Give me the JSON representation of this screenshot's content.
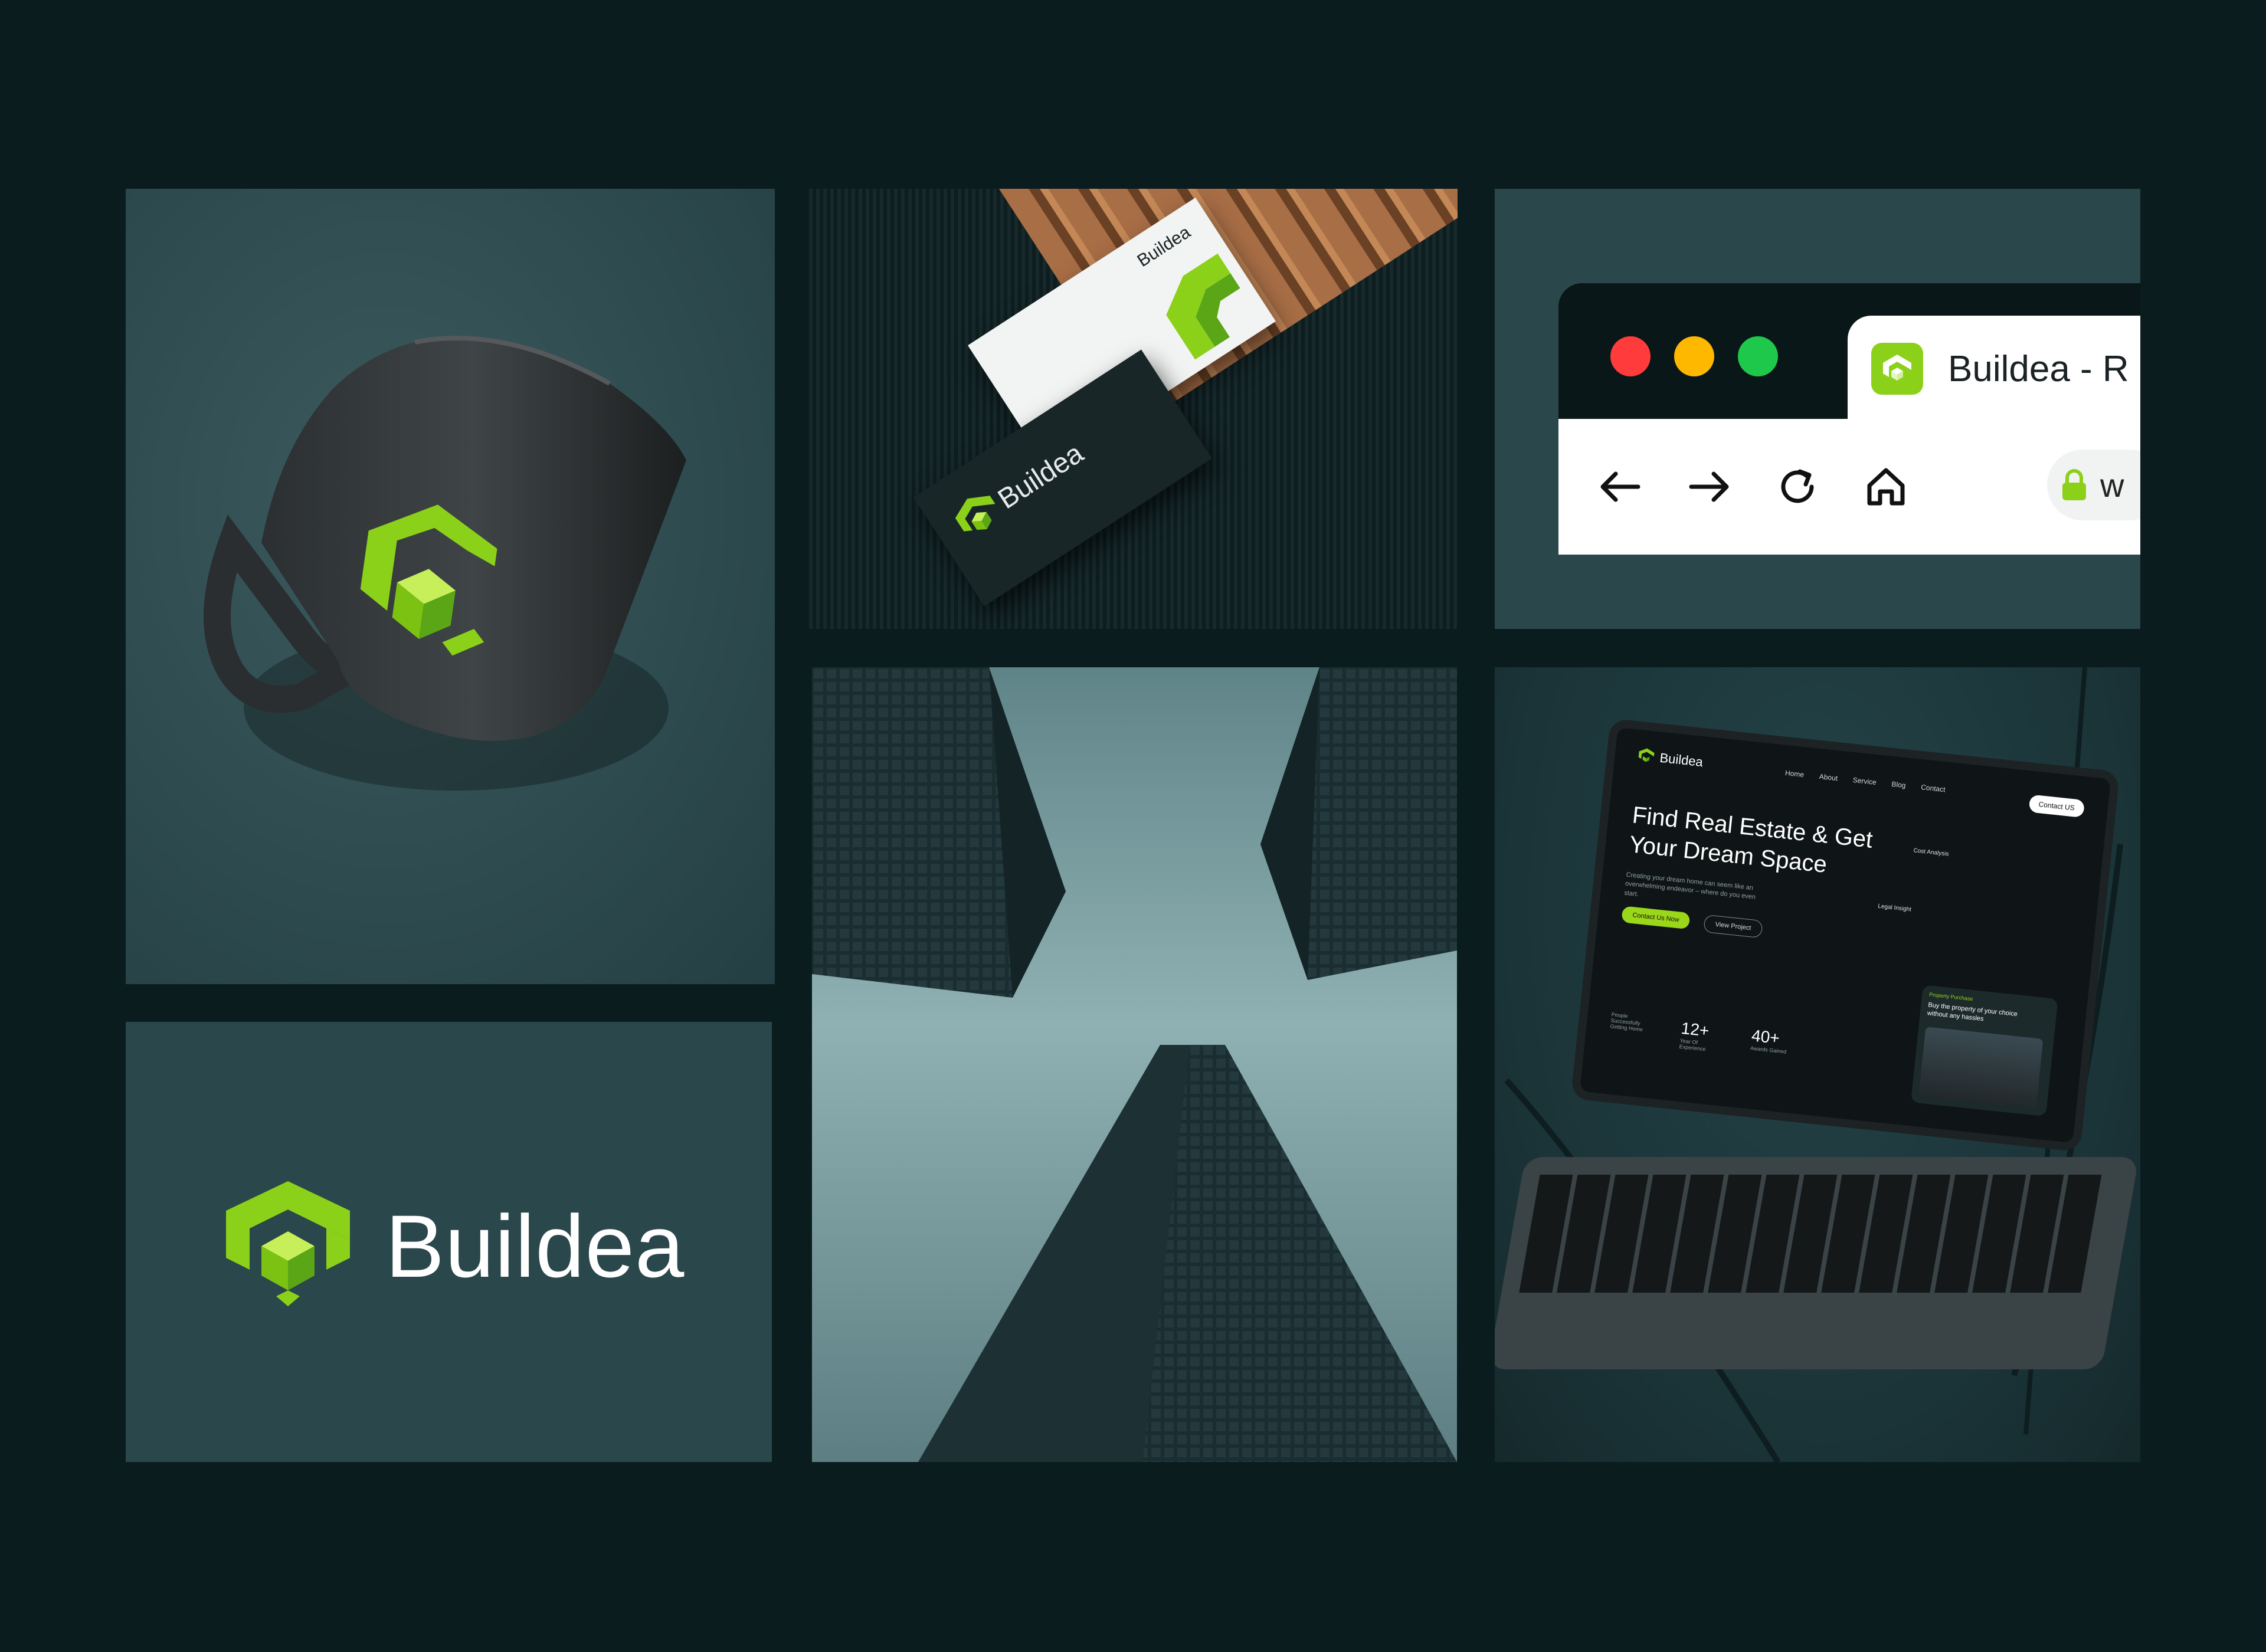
{
  "brand": {
    "name": "Buildea",
    "accent": "#8bd119",
    "accent_dark": "#5aa616"
  },
  "tiles": {
    "mug": {
      "name": "mug-mockup"
    },
    "logo": {
      "wordmark": "Buildea"
    },
    "card": {
      "front_brand": "Buildea",
      "back_brand": "Buildea"
    },
    "browser": {
      "tab_title": "Buildea - R",
      "url_fragment": "w",
      "traffic_colors": [
        "#ff3b3b",
        "#ffb800",
        "#1ec84a"
      ],
      "icons": [
        "back-arrow-icon",
        "forward-arrow-icon",
        "reload-icon",
        "home-icon",
        "lock-icon"
      ]
    },
    "laptop": {
      "brand": "Buildea",
      "nav": [
        "Home",
        "About",
        "Service",
        "Blog",
        "Contact"
      ],
      "contact_button": "Contact US",
      "hero_line1": "Find Real Estate & Get",
      "hero_line2": "Your Dream Space",
      "sub": "Creating your dream home can seem like an overwhelming endeavor – where do you even start.",
      "cta_primary": "Contact Us Now",
      "cta_secondary": "View Project",
      "tag1": "Cost Analysis",
      "tag2": "Legal Insight",
      "stats": [
        {
          "num": "",
          "label": "People Successfully Getting Home"
        },
        {
          "num": "12+",
          "label": "Year Of Experience"
        },
        {
          "num": "40+",
          "label": "Awards Gained"
        }
      ],
      "card_label": "Property Purchase",
      "card_text": "Buy the property of your choice without any hassles"
    }
  }
}
